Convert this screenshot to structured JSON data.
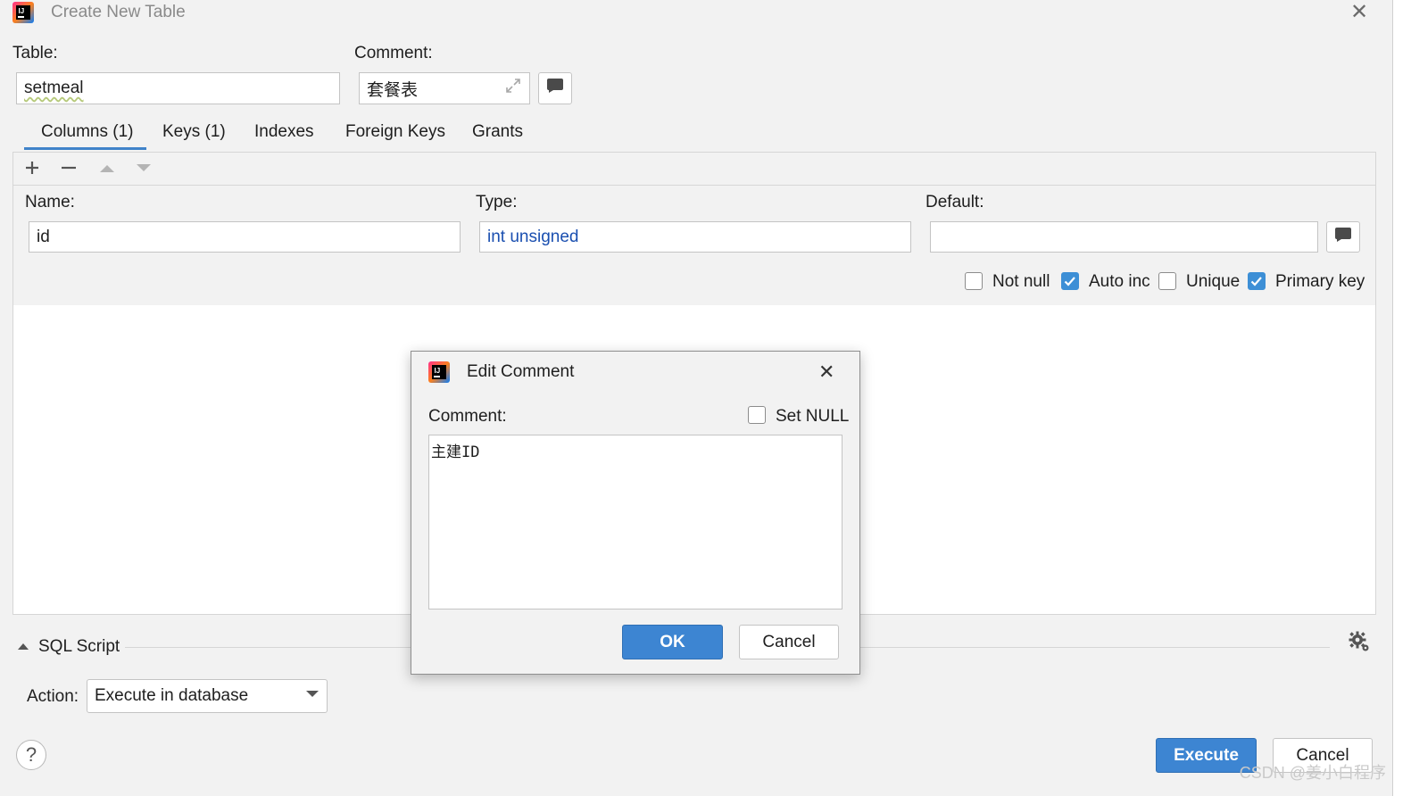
{
  "window": {
    "title": "Create New Table"
  },
  "table": {
    "label": "Table:",
    "name": "setmeal",
    "comment_label": "Comment:",
    "comment": "套餐表"
  },
  "tabs": [
    {
      "label": "Columns (1)",
      "active": true
    },
    {
      "label": "Keys (1)"
    },
    {
      "label": "Indexes"
    },
    {
      "label": "Foreign Keys"
    },
    {
      "label": "Grants"
    }
  ],
  "toolbar": {
    "add_icon": "plus-icon",
    "remove_icon": "minus-icon",
    "up_icon": "arrow-up-icon",
    "down_icon": "arrow-down-icon"
  },
  "column": {
    "name_label": "Name:",
    "name": "id",
    "type_label": "Type:",
    "type": "int unsigned",
    "default_label": "Default:",
    "default": "",
    "checkboxes": [
      {
        "label": "Not null",
        "checked": false
      },
      {
        "label": "Auto inc",
        "checked": true
      },
      {
        "label": "Unique",
        "checked": false
      },
      {
        "label": "Primary key",
        "checked": true
      }
    ]
  },
  "sql_script": {
    "label": "SQL Script"
  },
  "action": {
    "label": "Action:",
    "value": "Execute in database"
  },
  "buttons": {
    "execute": "Execute",
    "cancel": "Cancel"
  },
  "dialog": {
    "title": "Edit Comment",
    "comment_label": "Comment:",
    "set_null_label": "Set NULL",
    "set_null_checked": false,
    "text": "主建ID",
    "ok": "OK",
    "cancel": "Cancel"
  },
  "watermark": "CSDN @姜小白程序",
  "colors": {
    "accent": "#3d85d2",
    "type_text": "#1a4fb0"
  }
}
